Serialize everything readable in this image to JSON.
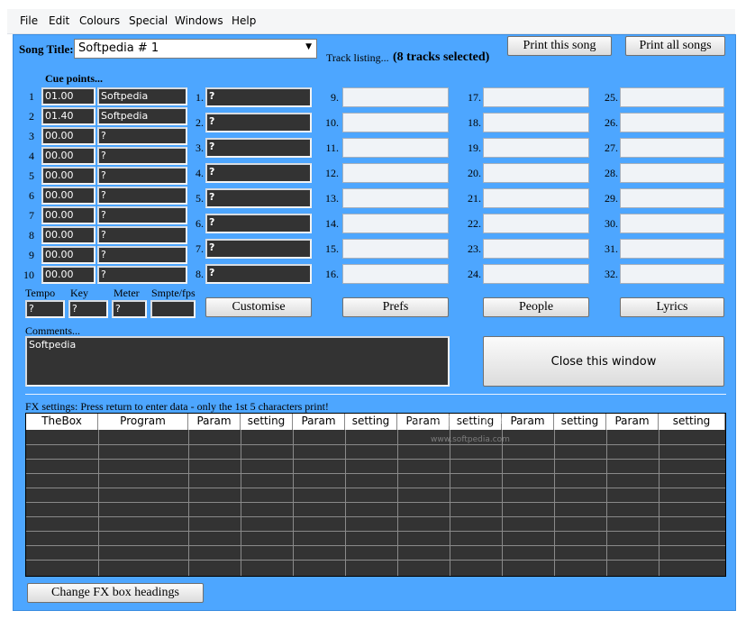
{
  "menu": [
    "File",
    "Edit",
    "Colours",
    "Special",
    "Windows",
    "Help"
  ],
  "song_title_label": "Song Title:",
  "song_title_value": "Softpedia # 1",
  "track_listing_label": "Track listing...",
  "tracks_selected": "(8 tracks selected)",
  "print_song": "Print this song",
  "print_all": "Print all songs",
  "cue_points_label": "Cue points...",
  "cues": [
    {
      "n": "1",
      "time": "01.00",
      "name": "Softpedia"
    },
    {
      "n": "2",
      "time": "01.40",
      "name": "Softpedia"
    },
    {
      "n": "3",
      "time": "00.00",
      "name": "?"
    },
    {
      "n": "4",
      "time": "00.00",
      "name": "?"
    },
    {
      "n": "5",
      "time": "00.00",
      "name": "?"
    },
    {
      "n": "6",
      "time": "00.00",
      "name": "?"
    },
    {
      "n": "7",
      "time": "00.00",
      "name": "?"
    },
    {
      "n": "8",
      "time": "00.00",
      "name": "?"
    },
    {
      "n": "9",
      "time": "00.00",
      "name": "?"
    },
    {
      "n": "10",
      "time": "00.00",
      "name": "?"
    }
  ],
  "tracks_col1": [
    {
      "n": "1.",
      "v": "?"
    },
    {
      "n": "2.",
      "v": "?"
    },
    {
      "n": "3.",
      "v": "?"
    },
    {
      "n": "4.",
      "v": "?"
    },
    {
      "n": "5.",
      "v": "?"
    },
    {
      "n": "6.",
      "v": "?"
    },
    {
      "n": "7.",
      "v": "?"
    },
    {
      "n": "8.",
      "v": "?"
    }
  ],
  "tracks_col2": [
    "9.",
    "10.",
    "11.",
    "12.",
    "13.",
    "14.",
    "15.",
    "16."
  ],
  "tracks_col3": [
    "17.",
    "18.",
    "19.",
    "20.",
    "21.",
    "22.",
    "23.",
    "24."
  ],
  "tracks_col4": [
    "25.",
    "26.",
    "27.",
    "28.",
    "29.",
    "30.",
    "31.",
    "32."
  ],
  "meta_labels": {
    "tempo": "Tempo",
    "key": "Key",
    "meter": "Meter",
    "smpte": "Smpte/fps"
  },
  "meta_values": {
    "tempo": "?",
    "key": "?",
    "meter": "?",
    "smpte": ""
  },
  "buttons": {
    "customise": "Customise",
    "prefs": "Prefs",
    "people": "People",
    "lyrics": "Lyrics",
    "close": "Close this window",
    "change_fx": "Change FX box headings"
  },
  "comments_label": "Comments...",
  "comments_value": "Softpedia",
  "fx_label": "FX settings:  Press return to enter data - only the 1st 5 characters print!",
  "fx_headers": [
    "TheBox",
    "Program",
    "Param",
    "setting",
    "Param",
    "setting",
    "Param",
    "setting",
    "Param",
    "setting",
    "Param",
    "setting"
  ],
  "watermark": "SOFTPEDIA",
  "watermark_url": "www.softpedia.com"
}
